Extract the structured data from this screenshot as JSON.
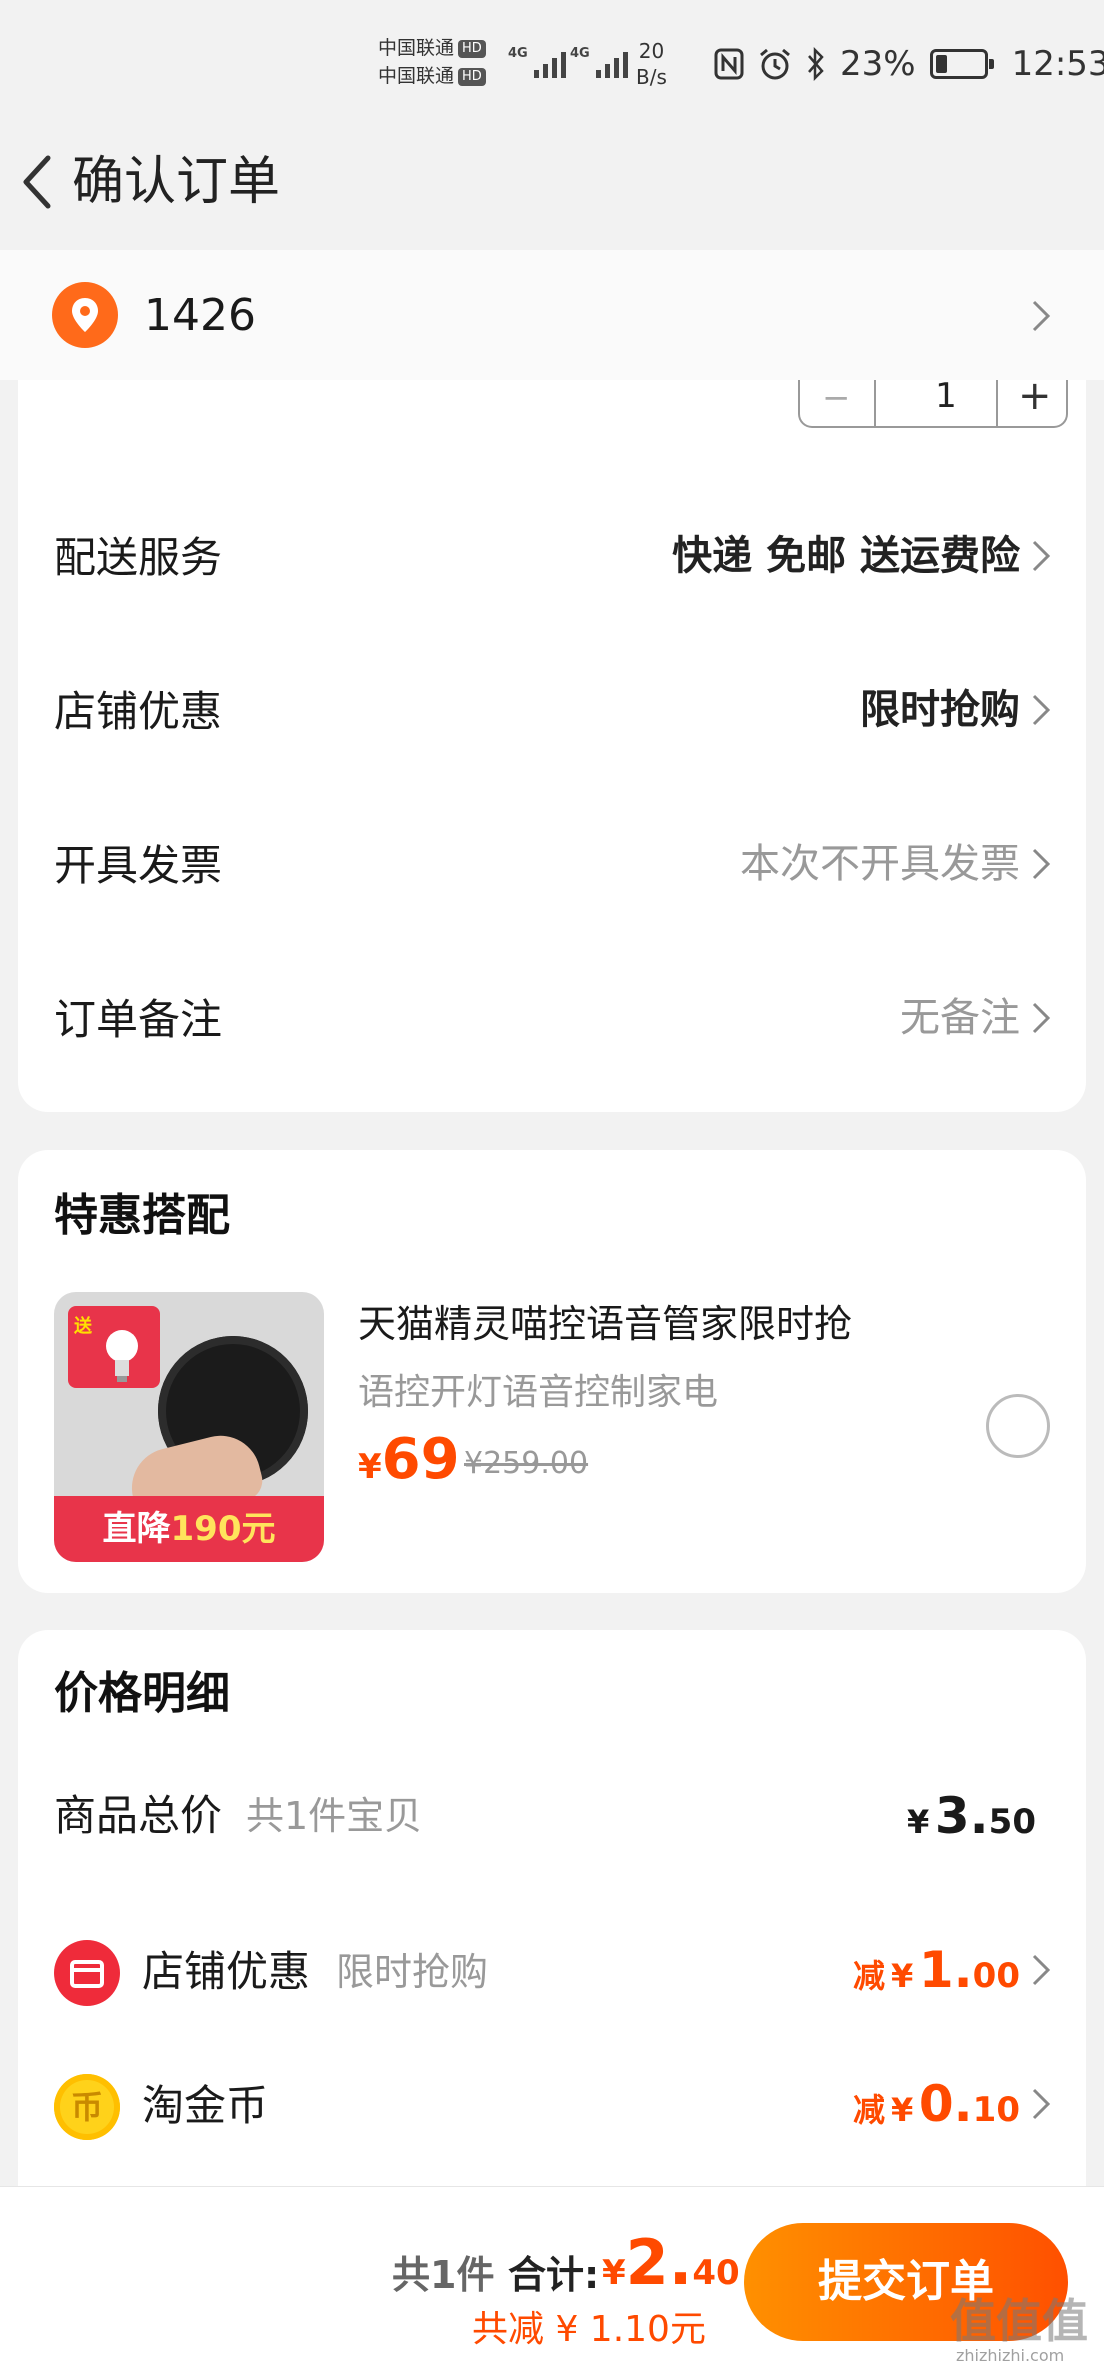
{
  "status_bar": {
    "carrier1": "中国联通",
    "carrier2": "中国联通",
    "hd": "HD",
    "network1": "4G",
    "network2": "4G",
    "speed_value": "20",
    "speed_unit": "B/s",
    "battery_pct": "23%",
    "battery_level": 0.23,
    "time": "12:53",
    "icons": [
      "nfc-icon",
      "alarm-icon",
      "bluetooth-icon"
    ]
  },
  "header": {
    "title": "确认订单"
  },
  "address": {
    "text": "1426"
  },
  "order_item": {
    "minus": "−",
    "quantity": "1",
    "plus": "+"
  },
  "rows": [
    {
      "label": "配送服务",
      "value": "快递 免邮 送运费险"
    },
    {
      "label": "店铺优惠",
      "value": "限时抢购"
    },
    {
      "label": "开具发票",
      "value": "本次不开具发票"
    },
    {
      "label": "订单备注",
      "value": "无备注"
    }
  ],
  "bundle": {
    "title": "特惠搭配",
    "gift_tag": "送",
    "banner_prefix": "直降",
    "banner_amount": "190元",
    "name": "天猫精灵喵控语音管家限时抢",
    "subtitle": "语控开灯语音控制家电",
    "price_symbol": "¥",
    "price": "69",
    "original_price": "¥259.00"
  },
  "price_detail": {
    "title": "价格明细",
    "total_label": "商品总价",
    "total_hint": "共1件宝贝",
    "total_symbol": "¥",
    "total_int": "3.",
    "total_dec": "50",
    "shop_discount_label": "店铺优惠",
    "shop_discount_hint": "限时抢购",
    "shop_discount_prefix": "减",
    "shop_discount_symbol": "¥",
    "shop_discount_int": "1.",
    "shop_discount_dec": "00",
    "coin_label": "淘金币",
    "coin_glyph": "币",
    "coin_prefix": "减",
    "coin_symbol": "¥",
    "coin_int": "0.",
    "coin_dec": "10"
  },
  "bottom_bar": {
    "count": "共1件",
    "total_label": "合计:",
    "total_symbol": "¥",
    "total_int": "2.",
    "total_dec": "40",
    "saved": "共减 ¥ 1.10元",
    "submit": "提交订单"
  },
  "watermark": {
    "text": "值值值",
    "sub": "zhizhizhi.com"
  },
  "colors": {
    "accent": "#ff4a00",
    "button_start": "#ff9000",
    "button_end": "#ff5000",
    "location_icon": "#ff6a1a",
    "banner_red": "#e8344a"
  }
}
